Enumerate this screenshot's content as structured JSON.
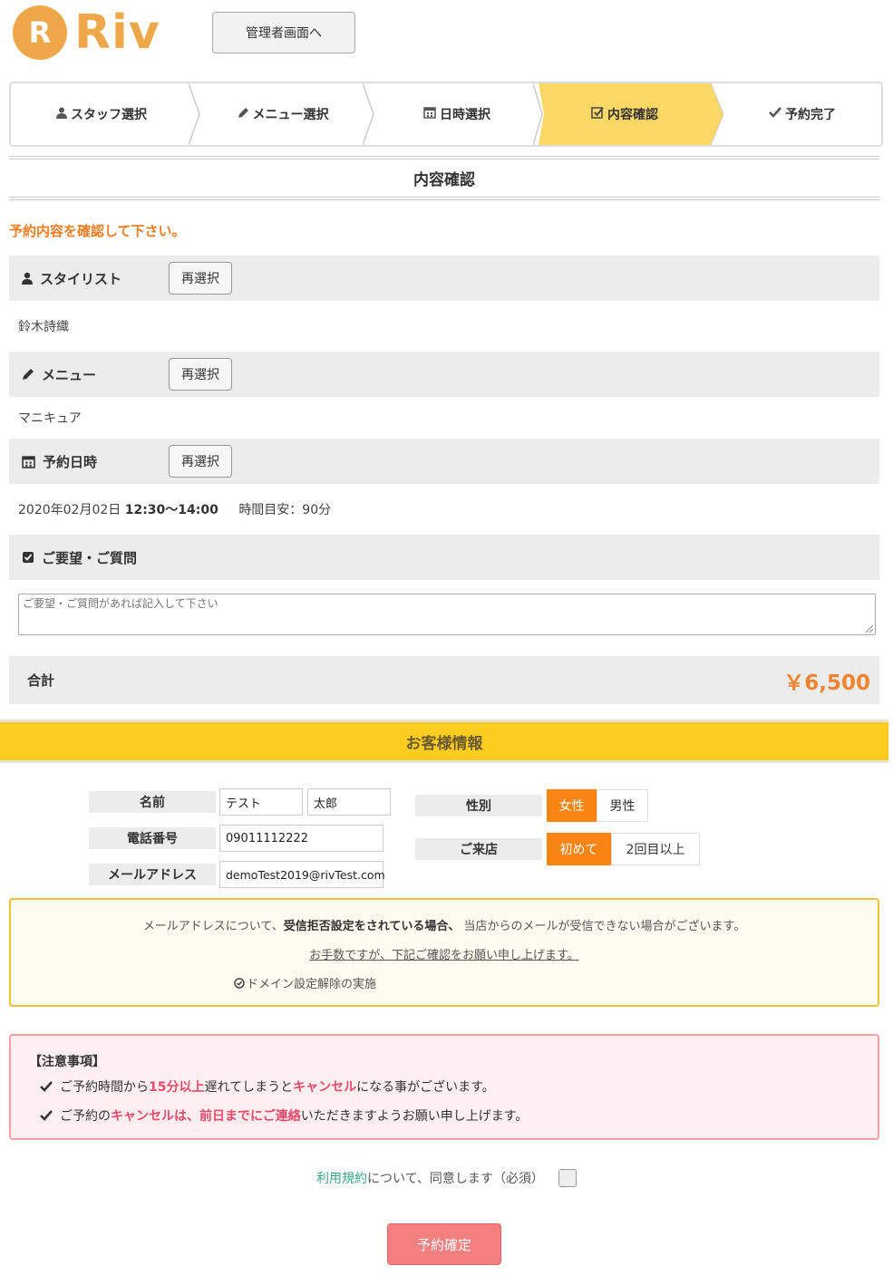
{
  "header": {
    "logo_letter": "R",
    "logo_text": "Riv",
    "admin_button": "管理者画面へ"
  },
  "steps": [
    {
      "label": "スタッフ選択",
      "icon": "user-icon",
      "active": false
    },
    {
      "label": "メニュー選択",
      "icon": "pencil-icon",
      "active": false
    },
    {
      "label": "日時選択",
      "icon": "calendar-icon",
      "active": false
    },
    {
      "label": "内容確認",
      "icon": "check-square-icon",
      "active": true
    },
    {
      "label": "予約完了",
      "icon": "check-icon",
      "active": false
    }
  ],
  "page_title": "内容確認",
  "confirm_notice": "予約内容を確認して下さい。",
  "stylist": {
    "label": "スタイリスト",
    "reselect": "再選択",
    "value": "鈴木詩織"
  },
  "menu": {
    "label": "メニュー",
    "reselect": "再選択",
    "value": "マニキュア"
  },
  "datetime": {
    "label": "予約日時",
    "reselect": "再選択",
    "date": "2020年02月02日",
    "time": "12:30〜14:00",
    "duration": "時間目安：90分"
  },
  "request": {
    "label": "ご要望・ご質問",
    "placeholder": "ご要望・ご質問があれば記入して下さい"
  },
  "total": {
    "label": "合計",
    "price": "￥6,500"
  },
  "customer": {
    "heading": "お客様情報",
    "name_label": "名前",
    "last_name": "テスト",
    "first_name": "太郎",
    "phone_label": "電話番号",
    "phone": "09011112222",
    "email_label": "メールアドレス",
    "email": "demoTest2019@rivTest.com",
    "gender_label": "性別",
    "gender_female": "女性",
    "gender_male": "男性",
    "visit_label": "ご来店",
    "visit_first": "初めて",
    "visit_repeat": "2回目以上"
  },
  "mail_notice": {
    "line1_pre": "メールアドレスについて、",
    "line1_bold": "受信拒否設定をされている場合、",
    "line1_post": "当店からのメールが受信できない場合がございます。",
    "line2": "お手数ですが、下記ご確認をお願い申し上げます。",
    "line3": "ドメイン設定解除の実施"
  },
  "caution": {
    "head": "【注意事項】",
    "r1_a": "ご予約時間から",
    "r1_b": "15分以上",
    "r1_c": "遅れてしまうと",
    "r1_d": "キャンセル",
    "r1_e": "になる事がございます。",
    "r2_a": "ご予約の",
    "r2_b": "キャンセルは、前日までにご連絡",
    "r2_c": "いただきますようお願い申し上げます。"
  },
  "agree": {
    "terms": "利用規約",
    "text": "について、同意します（必須）"
  },
  "submit": "予約確定",
  "colors": {
    "accent_yellow": "#fbd766",
    "band_yellow": "#fccd1e",
    "orange": "#f07c1e",
    "pink": "#e84a6c",
    "submit": "#f47f7f"
  }
}
